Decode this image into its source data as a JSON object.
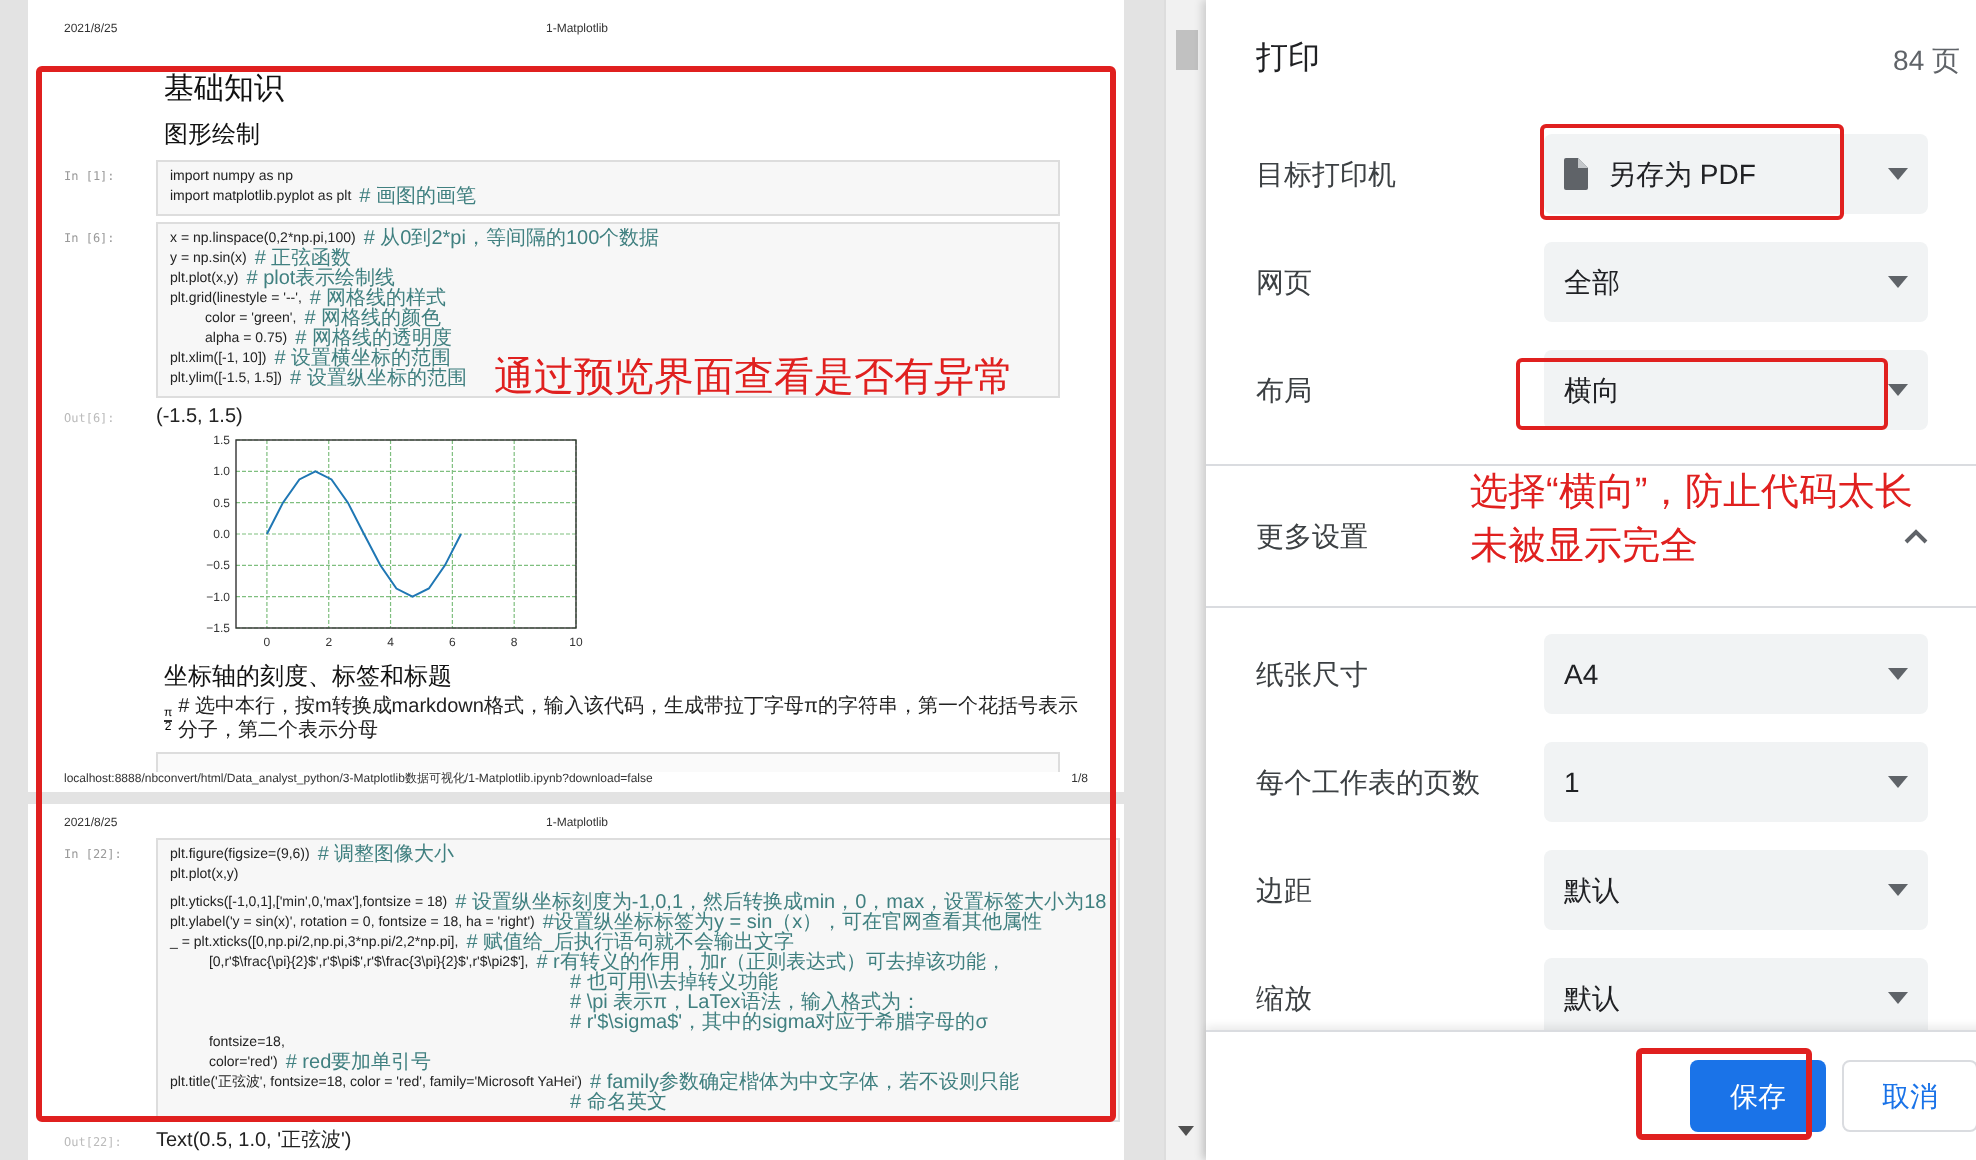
{
  "preview": {
    "pages": [
      {
        "header_date": "2021/8/25",
        "header_title": "1-Matplotlib",
        "blocks": [
          {
            "kind": "h1",
            "text": "基础知识"
          },
          {
            "kind": "h2",
            "text": "图形绘制"
          },
          {
            "kind": "in",
            "prompt": "In [1]:",
            "lines": [
              {
                "kind": "code",
                "code": "import numpy as np"
              },
              {
                "kind": "code",
                "code": "import matplotlib.pyplot as plt",
                "comment": "# 画图的画笔"
              }
            ]
          },
          {
            "kind": "in",
            "prompt": "In [6]:",
            "lines": [
              {
                "kind": "code",
                "code": "x = np.linspace(0,2*np.pi,100)",
                "comment": "# 从0到2*pi，等间隔的100个数据"
              },
              {
                "kind": "code",
                "code": "y = np.sin(x)",
                "comment": "# 正弦函数"
              },
              {
                "kind": "code",
                "code": "plt.plot(x,y)",
                "comment": "# plot表示绘制线"
              },
              {
                "kind": "code",
                "code": "plt.grid(linestyle = '--',",
                "comment": "# 网格线的样式"
              },
              {
                "kind": "code",
                "code": "         color = 'green',",
                "comment": "# 网格线的颜色"
              },
              {
                "kind": "code",
                "code": "         alpha = 0.75)",
                "comment": "# 网格线的透明度"
              },
              {
                "kind": "code",
                "code": "plt.xlim([-1, 10])",
                "comment": "# 设置横坐标的范围"
              },
              {
                "kind": "code",
                "code": "plt.ylim([-1.5, 1.5])",
                "comment": "# 设置纵坐标的范围"
              }
            ]
          },
          {
            "kind": "out",
            "prompt": "Out[6]:",
            "text": "(-1.5, 1.5)"
          },
          {
            "kind": "chart",
            "chart_data": {
              "type": "line",
              "grid": true,
              "x": [
                0,
                0.52,
                1.05,
                1.57,
                2.09,
                2.62,
                3.14,
                3.67,
                4.19,
                4.71,
                5.24,
                5.76,
                6.28
              ],
              "series": [
                {
                  "color": "#1f77b4",
                  "values": [
                    0,
                    0.5,
                    0.87,
                    1,
                    0.87,
                    0.5,
                    0,
                    -0.5,
                    -0.87,
                    -1,
                    -0.87,
                    -0.5,
                    0
                  ]
                }
              ],
              "xlim": [
                -1,
                10
              ],
              "ylim": [
                -1.5,
                1.5
              ],
              "xticks": [
                0,
                2,
                4,
                6,
                8,
                10
              ],
              "yticks": [
                {
                  "value": -1.5,
                  "label": "−1.5"
                },
                {
                  "value": -1,
                  "label": "−1.0"
                },
                {
                  "value": -0.5,
                  "label": "−0.5"
                },
                {
                  "value": 0,
                  "label": "0.0"
                },
                {
                  "value": 0.5,
                  "label": "0.5"
                },
                {
                  "value": 1,
                  "label": "1.0"
                },
                {
                  "value": 1.5,
                  "label": "1.5"
                }
              ]
            }
          },
          {
            "kind": "h2",
            "text": "坐标轴的刻度、标签和标题"
          },
          {
            "kind": "md",
            "num": "π",
            "den": "2",
            "text": "# 选中本行，按m转换成markdown格式，输入该代码，生成带拉丁字母π的字符串，第一个花括号表示分子，第二个表示分母"
          },
          {
            "kind": "empty_cell"
          }
        ],
        "footer_url": "localhost:8888/nbconvert/html/Data_analyst_python/3-Matplotlib数据可视化/1-Matplotlib.ipynb?download=false",
        "footer_page": "1/8"
      },
      {
        "header_date": "2021/8/25",
        "header_title": "1-Matplotlib",
        "blocks": [
          {
            "kind": "in",
            "prompt": "In [22]:",
            "lines": [
              {
                "kind": "code",
                "code": "plt.figure(figsize=(9,6))",
                "comment": "# 调整图像大小"
              },
              {
                "kind": "code",
                "code": "plt.plot(x,y)"
              },
              {
                "kind": "blank"
              },
              {
                "kind": "code",
                "code": "plt.yticks([-1,0,1],['min',0,'max'],fontsize = 18)",
                "comment": "# 设置纵坐标刻度为-1,0,1，然后转换成min，0，max，设置标签大小为18"
              },
              {
                "kind": "code",
                "code": "plt.ylabel('y = sin(x)', rotation = 0, fontsize = 18, ha = 'right')",
                "comment": "#设置纵坐标标签为y = sin（x），可在官网查看其他属性"
              },
              {
                "kind": "code",
                "code": "_ = plt.xticks([0,np.pi/2,np.pi,3*np.pi/2,2*np.pi],",
                "comment": "# 赋值给_后执行语句就不会输出文字"
              },
              {
                "kind": "code",
                "code": "          [0,r'$\\frac{\\pi}{2}$',r'$\\pi$',r'$\\frac{3\\pi}{2}$',r'$\\pi2$'],",
                "comment": "# r有转义的作用，加r（正则表达式）可去掉该功能，"
              },
              {
                "kind": "continuation",
                "comment": "# 也可用\\\\去掉转义功能"
              },
              {
                "kind": "continuation",
                "comment": "# \\pi 表示π，LaTex语法，输入格式为："
              },
              {
                "kind": "continuation",
                "comment": "# r'$\\sigma$'，其中的sigma对应于希腊字母的σ"
              },
              {
                "kind": "code",
                "code": "          fontsize=18,"
              },
              {
                "kind": "code",
                "code": "          color='red')",
                "comment": "# red要加单引号"
              },
              {
                "kind": "code",
                "code": "plt.title('正弦波', fontsize=18, color = 'red', family='Microsoft YaHei')",
                "comment": "# family参数确定楷体为中文字体，若不设则只能"
              },
              {
                "kind": "continuation",
                "comment": "# 命名英文"
              }
            ]
          },
          {
            "kind": "out",
            "prompt": "Out[22]:",
            "text": "Text(0.5, 1.0, '正弦波')"
          }
        ]
      }
    ]
  },
  "annotations": [
    {
      "text": "通过预览界面查看是否有异常"
    },
    {
      "text": "选择“横向”，防止代码太长未被显示完全"
    }
  ],
  "print_panel": {
    "title": "打印",
    "page_count": "84 页",
    "settings": [
      {
        "label": "目标打印机",
        "value": "另存为 PDF",
        "kind": "printer"
      },
      {
        "label": "网页",
        "value": "全部",
        "kind": "select"
      },
      {
        "label": "布局",
        "value": "横向",
        "kind": "select"
      }
    ],
    "more_settings": {
      "label": "更多设置",
      "expanded": true
    },
    "more": [
      {
        "label": "纸张尺寸",
        "value": "A4"
      },
      {
        "label": "每个工作表的页数",
        "value": "1"
      },
      {
        "label": "边距",
        "value": "默认"
      },
      {
        "label": "缩放",
        "value": "默认"
      }
    ],
    "buttons": [
      {
        "label": "保存",
        "kind": "primary"
      },
      {
        "label": "取消",
        "kind": "secondary"
      }
    ]
  }
}
